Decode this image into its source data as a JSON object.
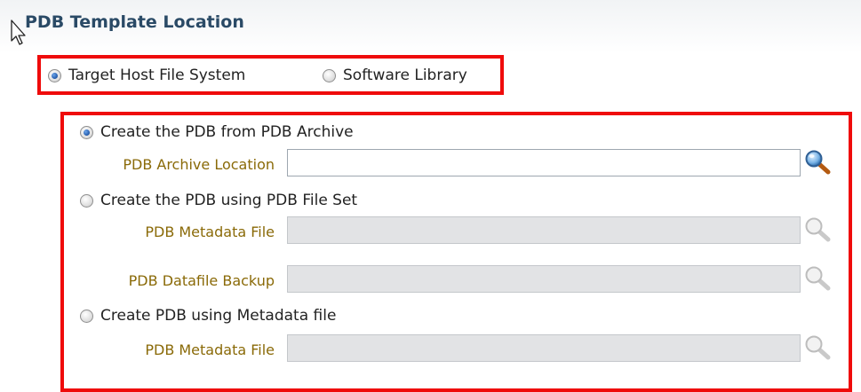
{
  "section": {
    "title": "PDB Template Location"
  },
  "source": {
    "options": [
      {
        "label": "Target Host File System",
        "checked": true
      },
      {
        "label": "Software Library",
        "checked": false
      }
    ]
  },
  "options": [
    {
      "label": "Create the PDB from PDB Archive",
      "checked": true,
      "fields": [
        {
          "label": "PDB Archive Location",
          "value": "",
          "enabled": true,
          "icon": "search-icon"
        }
      ]
    },
    {
      "label": "Create the PDB using PDB File Set",
      "checked": false,
      "fields": [
        {
          "label": "PDB Metadata File",
          "value": "",
          "enabled": false,
          "icon": "search-icon"
        },
        {
          "label": "PDB Datafile Backup",
          "value": "",
          "enabled": false,
          "icon": "search-icon"
        }
      ]
    },
    {
      "label": "Create PDB using Metadata file",
      "checked": false,
      "fields": [
        {
          "label": "PDB Metadata File",
          "value": "",
          "enabled": false,
          "icon": "search-icon"
        }
      ]
    }
  ],
  "colors": {
    "highlight_border": "#ef0b0b",
    "title": "#2a4a66",
    "field_label": "#8a6a08",
    "disabled_input": "#e2e3e5"
  }
}
